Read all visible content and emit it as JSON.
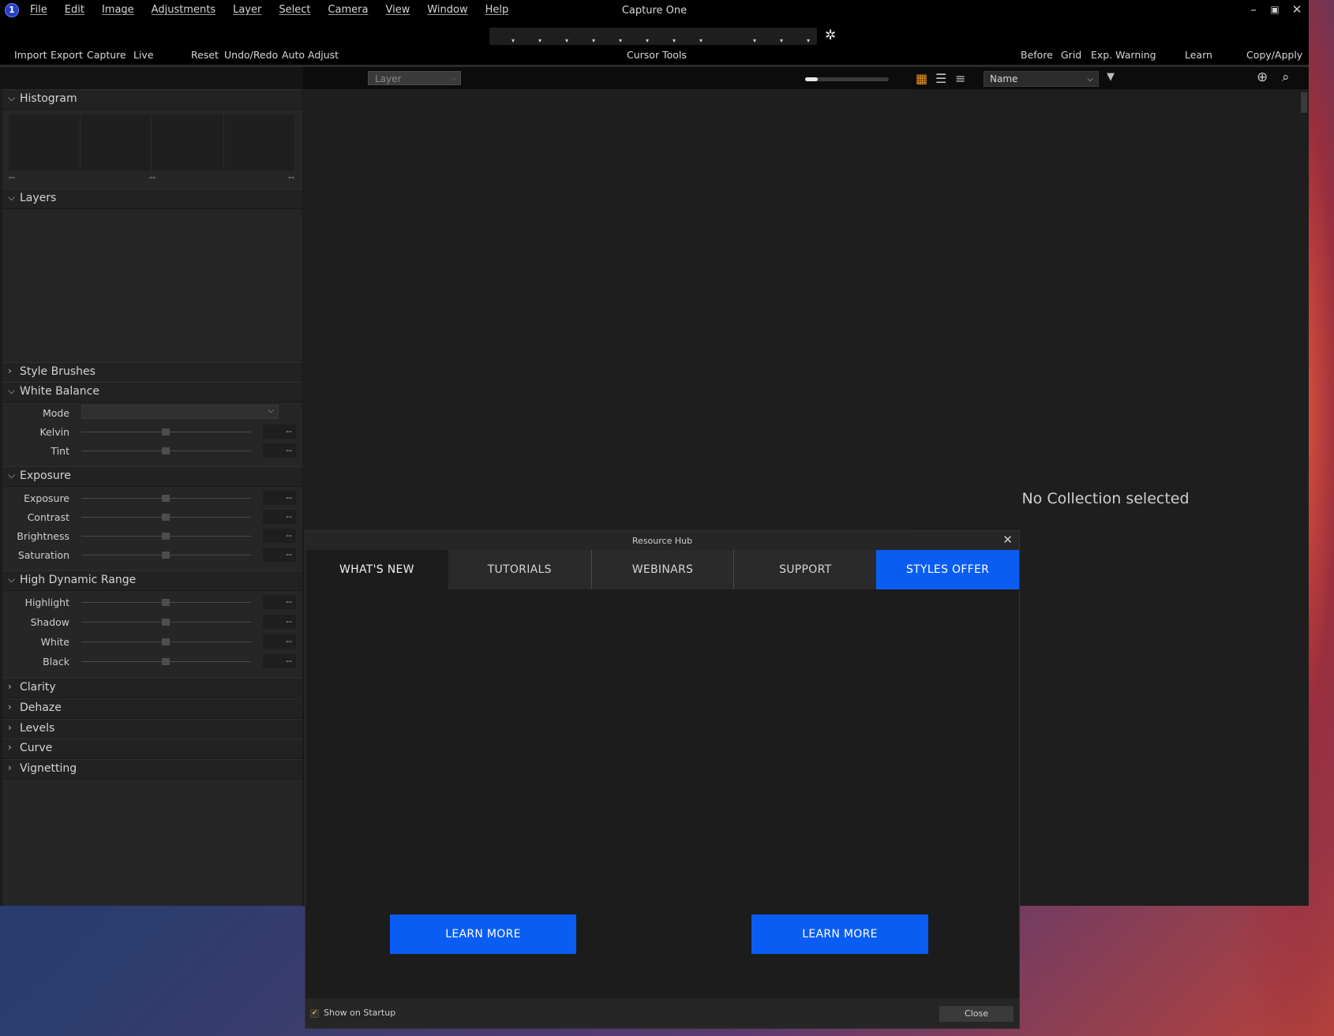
{
  "app": {
    "title": "Capture One",
    "logo_glyph": "1",
    "menu": [
      "File",
      "Edit",
      "Image",
      "Adjustments",
      "Layer",
      "Select",
      "Camera",
      "View",
      "Window",
      "Help"
    ]
  },
  "toolbar": {
    "left": [
      "Import",
      "Export",
      "Capture",
      "Live"
    ],
    "middle": [
      "Reset",
      "Undo/Redo",
      "Auto Adjust"
    ],
    "cursor_tools": "Cursor Tools",
    "right": [
      "Before",
      "Grid",
      "Exp. Warning",
      "Learn",
      "Copy/Apply"
    ]
  },
  "subbar": {
    "layer_select": "Layer",
    "sort_select": "Name",
    "zoom_fraction": 0.15
  },
  "left_panel": {
    "histogram": {
      "title": "Histogram",
      "labels": [
        "--",
        "--",
        "--"
      ]
    },
    "layers": {
      "title": "Layers"
    },
    "style_brushes": {
      "title": "Style Brushes"
    },
    "white_balance": {
      "title": "White Balance",
      "mode_label": "Mode",
      "rows": [
        {
          "label": "Kelvin",
          "value": "--"
        },
        {
          "label": "Tint",
          "value": "--"
        }
      ]
    },
    "exposure": {
      "title": "Exposure",
      "rows": [
        {
          "label": "Exposure",
          "value": "--"
        },
        {
          "label": "Contrast",
          "value": "--"
        },
        {
          "label": "Brightness",
          "value": "--"
        },
        {
          "label": "Saturation",
          "value": "--"
        }
      ]
    },
    "hdr": {
      "title": "High Dynamic Range",
      "rows": [
        {
          "label": "Highlight",
          "value": "--"
        },
        {
          "label": "Shadow",
          "value": "--"
        },
        {
          "label": "White",
          "value": "--"
        },
        {
          "label": "Black",
          "value": "--"
        }
      ]
    },
    "collapsed": [
      {
        "title": "Clarity"
      },
      {
        "title": "Dehaze"
      },
      {
        "title": "Levels"
      },
      {
        "title": "Curve"
      },
      {
        "title": "Vignetting"
      }
    ]
  },
  "browser": {
    "empty_text": "No Collection selected"
  },
  "dialog": {
    "title": "Resource Hub",
    "tabs": [
      "WHAT'S NEW",
      "TUTORIALS",
      "WEBINARS",
      "SUPPORT",
      "STYLES OFFER"
    ],
    "learn_more": [
      "LEARN MORE",
      "LEARN MORE"
    ],
    "show_on_startup": "Show on Startup",
    "show_on_startup_checked": true,
    "close_label": "Close"
  },
  "colors": {
    "accent_blue": "#0a5df2",
    "check_orange": "#f5a623",
    "grid_icon_orange": "#f59b1f"
  }
}
